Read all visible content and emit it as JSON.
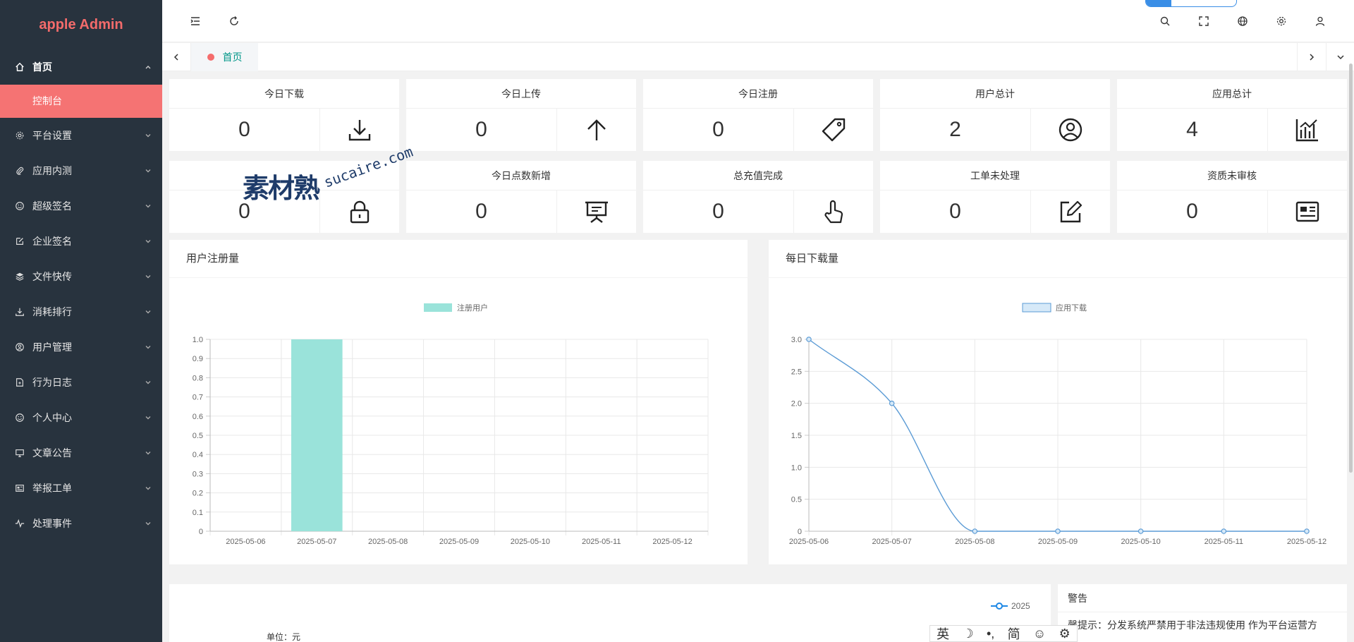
{
  "brand": "apple Admin",
  "nav": {
    "home": "首页",
    "sub_active": "控制台",
    "items": [
      {
        "label": "平台设置",
        "icon": "gear-icon"
      },
      {
        "label": "应用内测",
        "icon": "paperclip-icon"
      },
      {
        "label": "超级签名",
        "icon": "smile-icon"
      },
      {
        "label": "企业签名",
        "icon": "edit-icon"
      },
      {
        "label": "文件快传",
        "icon": "layers-icon"
      },
      {
        "label": "消耗排行",
        "icon": "download-icon"
      },
      {
        "label": "用户管理",
        "icon": "user-circle-icon"
      },
      {
        "label": "行为日志",
        "icon": "file-icon"
      },
      {
        "label": "个人中心",
        "icon": "smile-icon"
      },
      {
        "label": "文章公告",
        "icon": "monitor-icon"
      },
      {
        "label": "举报工单",
        "icon": "card-icon"
      },
      {
        "label": "处理事件",
        "icon": "pulse-icon"
      }
    ]
  },
  "tabs": {
    "home": "首页"
  },
  "stats": [
    {
      "title": "今日下载",
      "value": "0",
      "icon": "download-icon"
    },
    {
      "title": "今日上传",
      "value": "0",
      "icon": "arrow-up-icon"
    },
    {
      "title": "今日注册",
      "value": "0",
      "icon": "tag-icon"
    },
    {
      "title": "用户总计",
      "value": "2",
      "icon": "user-circle-icon"
    },
    {
      "title": "应用总计",
      "value": "4",
      "icon": "chart-icon"
    },
    {
      "title": "",
      "value": "0",
      "icon": "lock-icon"
    },
    {
      "title": "今日点数新增",
      "value": "0",
      "icon": "presentation-icon"
    },
    {
      "title": "总充值完成",
      "value": "0",
      "icon": "hand-pointer-icon"
    },
    {
      "title": "工单未处理",
      "value": "0",
      "icon": "edit-icon"
    },
    {
      "title": "资质未审核",
      "value": "0",
      "icon": "id-card-icon"
    }
  ],
  "watermark": {
    "main": "素材熟",
    "sub": "sucaire.com"
  },
  "panels": {
    "register_title": "用户注册量",
    "download_title": "每日下载量"
  },
  "chart_data": [
    {
      "type": "bar",
      "title": "用户注册量",
      "categories": [
        "2025-05-06",
        "2025-05-07",
        "2025-05-08",
        "2025-05-09",
        "2025-05-10",
        "2025-05-11",
        "2025-05-12"
      ],
      "series": [
        {
          "name": "注册用户",
          "values": [
            0,
            1,
            0,
            0,
            0,
            0,
            0
          ]
        }
      ],
      "ylim": [
        0,
        1.0
      ],
      "yticks": [
        "0",
        "0.1",
        "0.2",
        "0.3",
        "0.4",
        "0.5",
        "0.6",
        "0.7",
        "0.8",
        "0.9",
        "1.0"
      ],
      "color": "#9ae3da",
      "legend": "top"
    },
    {
      "type": "line",
      "title": "每日下载量",
      "categories": [
        "2025-05-06",
        "2025-05-07",
        "2025-05-08",
        "2025-05-09",
        "2025-05-10",
        "2025-05-11",
        "2025-05-12"
      ],
      "series": [
        {
          "name": "应用下载",
          "values": [
            3,
            2,
            0,
            0,
            0,
            0,
            0
          ]
        }
      ],
      "ylim": [
        0,
        3.0
      ],
      "yticks": [
        "0",
        "0.5",
        "1.0",
        "1.5",
        "2.0",
        "2.5",
        "3.0"
      ],
      "color": "#5b9bd5",
      "legend": "top"
    }
  ],
  "bottom": {
    "legend": "2025",
    "unit": "单位：元",
    "warn_title": "警告",
    "warn_text": "馨提示：分发系统严禁用于非法违规使用 作为平台运营方"
  },
  "ime": [
    "英",
    "☽",
    "•,",
    "简",
    "☺",
    "⚙"
  ]
}
